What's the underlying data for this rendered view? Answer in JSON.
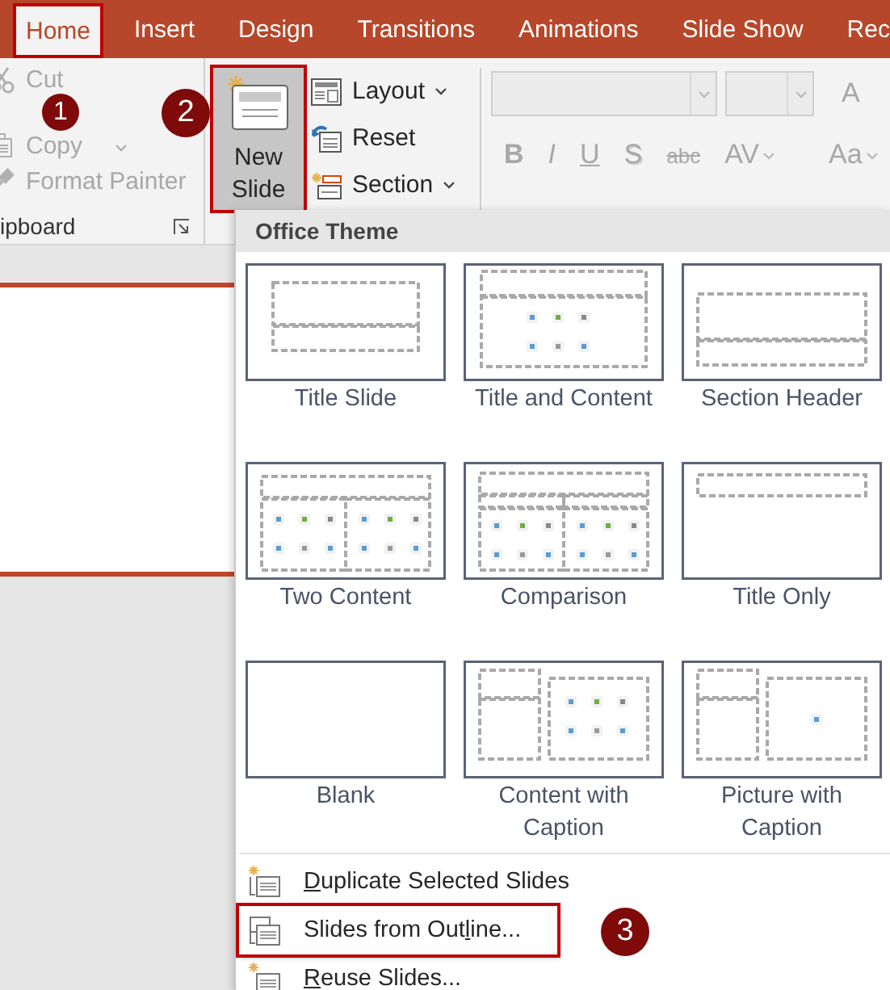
{
  "tabs": [
    {
      "label": "Home",
      "selected": true,
      "highlighted": true
    },
    {
      "label": "Insert",
      "selected": false,
      "highlighted": false
    },
    {
      "label": "Design",
      "selected": false,
      "highlighted": false
    },
    {
      "label": "Transitions",
      "selected": false,
      "highlighted": false
    },
    {
      "label": "Animations",
      "selected": false,
      "highlighted": false
    },
    {
      "label": "Slide Show",
      "selected": false,
      "highlighted": false
    },
    {
      "label": "Rec",
      "selected": false,
      "highlighted": false
    }
  ],
  "clipboard": {
    "group_label": "ipboard",
    "items": [
      {
        "kind": "cut",
        "label": "Cut",
        "disabled": true
      },
      {
        "kind": "copy",
        "label": "Copy",
        "disabled": true
      },
      {
        "kind": "format-painter",
        "label": "Format Painter",
        "disabled": true
      }
    ]
  },
  "new_slide": {
    "label": "New Slide",
    "pressed": true,
    "highlighted": true
  },
  "slide_commands": [
    {
      "kind": "layout",
      "label": "Layout",
      "has_menu": true
    },
    {
      "kind": "reset",
      "label": "Reset",
      "has_menu": false
    },
    {
      "kind": "section",
      "label": "Section",
      "has_menu": true
    }
  ],
  "font_group": {
    "disabled": true,
    "grow_label": "A",
    "format_buttons": [
      {
        "kind": "bold",
        "label": "B"
      },
      {
        "kind": "italic",
        "label": "I"
      },
      {
        "kind": "underline",
        "label": "U"
      },
      {
        "kind": "shadow",
        "label": "S"
      },
      {
        "kind": "strike",
        "label": "abc"
      },
      {
        "kind": "spacing",
        "label": "AV"
      },
      {
        "kind": "case",
        "label": "Aa"
      }
    ]
  },
  "slides": [
    {
      "selected": true
    }
  ],
  "menu": {
    "header": "Office Theme",
    "layouts": [
      {
        "kind": "title",
        "label": "Title Slide"
      },
      {
        "kind": "title-content",
        "label": "Title and Content"
      },
      {
        "kind": "section",
        "label": "Section Header"
      },
      {
        "kind": "two-content",
        "label": "Two Content"
      },
      {
        "kind": "comparison",
        "label": "Comparison"
      },
      {
        "kind": "title-only",
        "label": "Title Only"
      },
      {
        "kind": "blank",
        "label": "Blank"
      },
      {
        "kind": "content-caption",
        "label": "Content with Caption"
      },
      {
        "kind": "picture-caption",
        "label": "Picture with Caption"
      }
    ],
    "items": [
      {
        "kind": "duplicate",
        "access_key": "D",
        "label_after": "uplicate Selected Slides",
        "highlighted": false
      },
      {
        "kind": "outline",
        "label_before": "Slides from Out",
        "access_key": "l",
        "label_after": "ine...",
        "highlighted": true
      },
      {
        "kind": "reuse",
        "access_key": "R",
        "label_after": "euse Slides...",
        "highlighted": false
      }
    ]
  },
  "annotations": [
    {
      "label": "1"
    },
    {
      "label": "2"
    },
    {
      "label": "3"
    }
  ]
}
